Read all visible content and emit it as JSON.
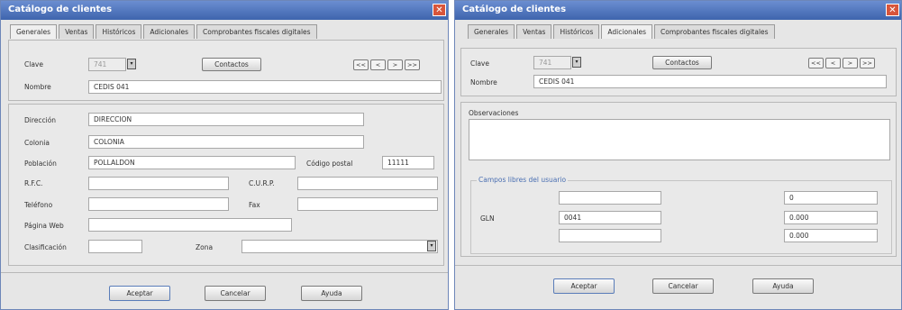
{
  "left": {
    "title": "Catálogo de clientes",
    "tabs": [
      "Generales",
      "Ventas",
      "Históricos",
      "Adicionales",
      "Comprobantes fiscales digitales"
    ],
    "clave_label": "Clave",
    "clave_value": "741",
    "contactos_label": "Contactos",
    "nav": [
      "<<",
      "<",
      ">",
      ">>"
    ],
    "nombre_label": "Nombre",
    "nombre_value": "CEDIS 041",
    "direccion_label": "Dirección",
    "direccion_value": "DIRECCION",
    "colonia_label": "Colonia",
    "colonia_value": "COLONIA",
    "poblacion_label": "Población",
    "poblacion_value": "POLLALDON",
    "cp_label": "Código postal",
    "cp_value": "11111",
    "rfc_label": "R.F.C.",
    "rfc_value": "",
    "curp_label": "C.U.R.P.",
    "curp_value": "",
    "telefono_label": "Teléfono",
    "telefono_value": "",
    "fax_label": "Fax",
    "fax_value": "",
    "web_label": "Página Web",
    "web_value": "",
    "clasificacion_label": "Clasificación",
    "clasificacion_value": "",
    "zona_label": "Zona",
    "zona_value": "",
    "aceptar": "Aceptar",
    "cancelar": "Cancelar",
    "ayuda": "Ayuda"
  },
  "right": {
    "title": "Catálogo de clientes",
    "tabs": [
      "Generales",
      "Ventas",
      "Históricos",
      "Adicionales",
      "Comprobantes fiscales digitales"
    ],
    "clave_label": "Clave",
    "clave_value": "741",
    "contactos_label": "Contactos",
    "nav": [
      "<<",
      "<",
      ">",
      ">>"
    ],
    "nombre_label": "Nombre",
    "nombre_value": "CEDIS 041",
    "observaciones_label": "Observaciones",
    "observaciones_value": "",
    "group_title": "Campos libres del usuario",
    "gln_label": "GLN",
    "col1": [
      "",
      "0041",
      ""
    ],
    "col2": [
      "0",
      "0.000",
      "0.000"
    ],
    "aceptar": "Aceptar",
    "cancelar": "Cancelar",
    "ayuda": "Ayuda"
  }
}
